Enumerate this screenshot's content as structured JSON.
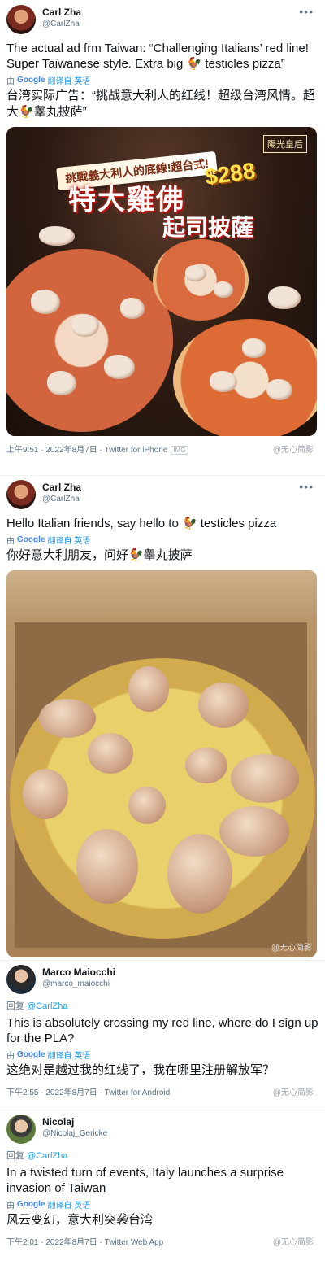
{
  "tweets": [
    {
      "name": "Carl Zha",
      "handle": "@CarlZha",
      "more": "•••",
      "text_en": "The actual ad frm Taiwan: “Challenging Italians’ red line! Super Taiwanese style. Extra big 🐓 testicles pizza”",
      "translate_prefix": "由",
      "translate_brand": "Google",
      "translate_link": "翻译自 英语",
      "text_zh": "台湾实际广告：“挑战意大利人的红线！超级台湾风情。超大🐓睾丸披萨”",
      "meta": "上午9:51 · 2022年8月7日 · Twitter for iPhone",
      "badge": "IMG"
    },
    {
      "name": "Carl Zha",
      "handle": "@CarlZha",
      "more": "•••",
      "text_en": "Hello Italian friends, say hello to 🐓 testicles pizza",
      "translate_prefix": "由",
      "translate_brand": "Google",
      "translate_link": "翻译自 英语",
      "text_zh": "你好意大利朋友，问好🐓睾丸披萨"
    },
    {
      "name": "Marco Maiocchi",
      "handle": "@marco_maiocchi",
      "reply_label": "回复",
      "reply_to": "@CarlZha",
      "text_en": "This is absolutely crossing my red line, where do I sign up for the PLA?",
      "translate_prefix": "由",
      "translate_brand": "Google",
      "translate_link": "翻译自 英语",
      "text_zh": "这绝对是越过我的红线了，我在哪里注册解放军？",
      "meta": "下午2:55 · 2022年8月7日 · Twitter for Android"
    },
    {
      "name": "Nicolaj",
      "handle": "@Nicolaj_Gericke",
      "reply_label": "回复",
      "reply_to": "@CarlZha",
      "text_en": "In a twisted turn of events, Italy launches a surprise invasion of Taiwan",
      "translate_prefix": "由",
      "translate_brand": "Google",
      "translate_link": "翻译自 英语",
      "text_zh": "风云变幻，意大利突袭台湾",
      "meta": "下午2:01 · 2022年8月7日 · Twitter Web App"
    }
  ],
  "ad_image": {
    "banner": "挑戰義大利人的底線!超台式!",
    "headline": "特大雞佛",
    "price": "$288",
    "subline": "起司披薩",
    "logo": "陽光皇后"
  },
  "watermark": "@无心简影",
  "icons": {
    "rooster": "rooster-emoji-icon",
    "more": "more-dots-icon",
    "translate": "google-translate-icon"
  }
}
